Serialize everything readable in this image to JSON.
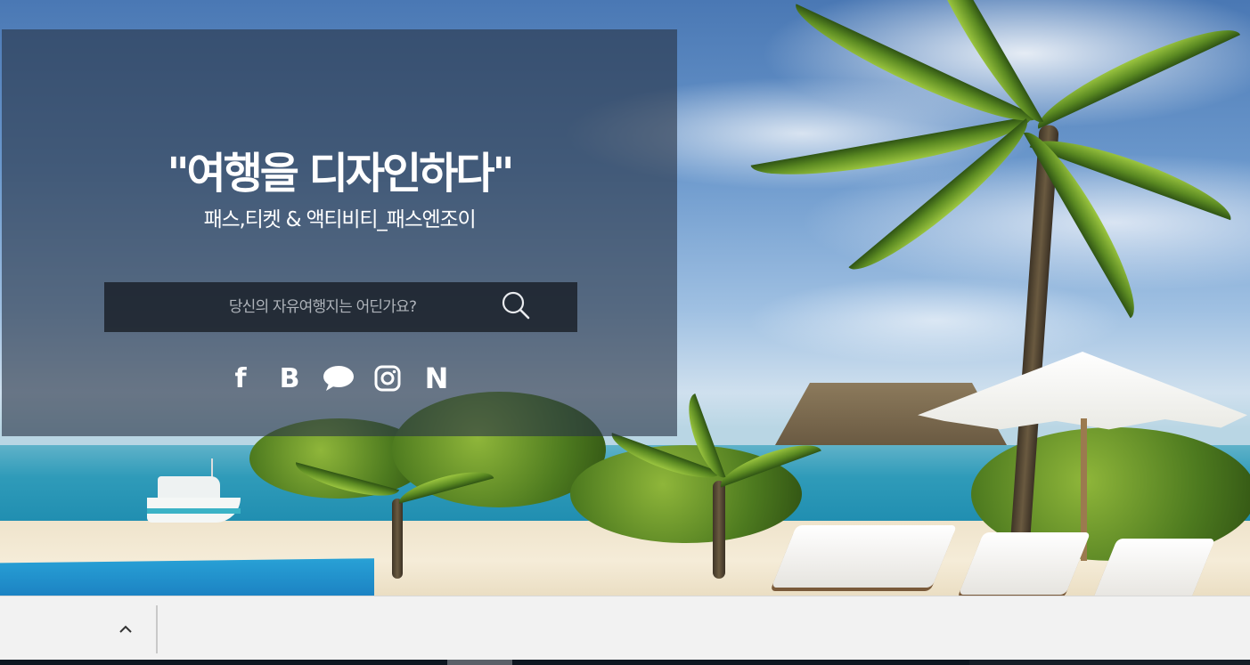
{
  "hero": {
    "headline": "\"여행을 디자인하다\"",
    "subtitle": "패스,티켓 & 액티비티_패스엔조이"
  },
  "search": {
    "placeholder": "당신의 자유여행지는 어딘가요?",
    "icon": "search-icon"
  },
  "social": {
    "items": [
      {
        "name": "facebook",
        "icon": "facebook-icon",
        "glyph": "f"
      },
      {
        "name": "blog",
        "icon": "blog-icon",
        "glyph": "B"
      },
      {
        "name": "kakaotalk",
        "icon": "chat-bubble-icon",
        "glyph": ""
      },
      {
        "name": "instagram",
        "icon": "instagram-icon",
        "glyph": ""
      },
      {
        "name": "naver",
        "icon": "naver-icon",
        "glyph": "N"
      }
    ]
  },
  "bottom_bar": {
    "scroll_top_icon": "chevron-up-icon"
  },
  "colors": {
    "panel_overlay": "#283446",
    "search_bg": "#161b22",
    "bottom_bar_bg": "#f2f2f2",
    "footer_strip": "#0d1620"
  }
}
